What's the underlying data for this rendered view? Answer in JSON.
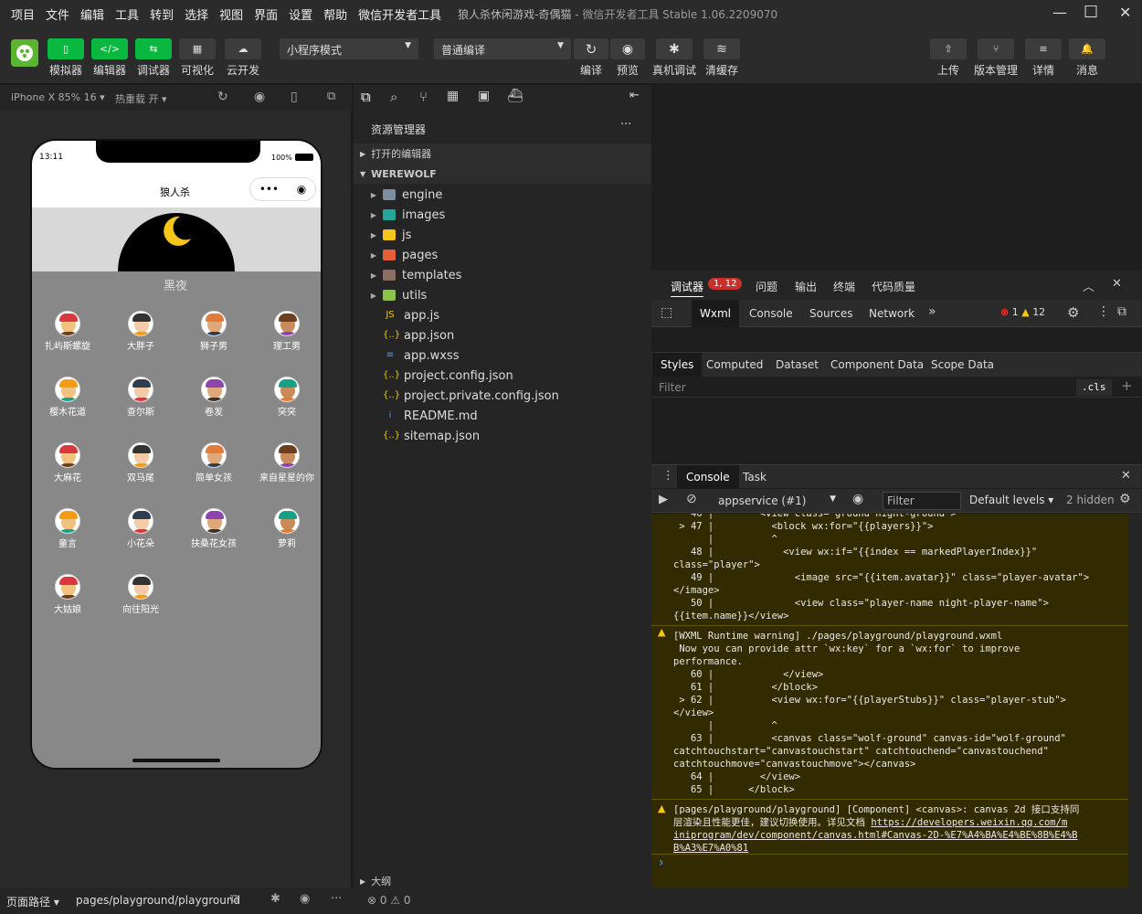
{
  "menu": [
    "项目",
    "文件",
    "编辑",
    "工具",
    "转到",
    "选择",
    "视图",
    "界面",
    "设置",
    "帮助",
    "微信开发者工具"
  ],
  "window": {
    "title": "狼人杀休闲游戏-奇偶猫",
    "subtitle": "- 微信开发者工具 Stable 1.06.2209070",
    "minimize": "—",
    "maximize": "☐",
    "close": "✕"
  },
  "toolbar": {
    "left": [
      {
        "label": "模拟器",
        "glyph": "▯"
      },
      {
        "label": "编辑器",
        "glyph": "</>"
      },
      {
        "label": "调试器",
        "glyph": "⇆"
      },
      {
        "label": "可视化",
        "glyph": "▦"
      },
      {
        "label": "云开发",
        "glyph": "☁"
      }
    ],
    "mode_select": "小程序模式",
    "compile_select": "普通编译",
    "middle": [
      {
        "label": "编译",
        "glyph": "↻"
      },
      {
        "label": "预览",
        "glyph": "◉"
      },
      {
        "label": "真机调试",
        "glyph": "✱"
      },
      {
        "label": "清缓存",
        "glyph": "≋"
      }
    ],
    "right": [
      {
        "label": "上传",
        "glyph": "⇧"
      },
      {
        "label": "版本管理",
        "glyph": "⑂"
      },
      {
        "label": "详情",
        "glyph": "≡"
      },
      {
        "label": "消息",
        "glyph": "🔔"
      }
    ]
  },
  "simbar": {
    "device": "iPhone X 85% 16 ▾",
    "hotreload": "热重载 开 ▾"
  },
  "phone": {
    "time": "13:11",
    "battery": "100%",
    "title": "狼人杀",
    "night_label": "黑夜",
    "players": [
      "扎屿斯螺旋",
      "大胖子",
      "狮子男",
      "理工男",
      "樱木花道",
      "查尔斯",
      "卷发",
      "突突",
      "大麻花",
      "双马尾",
      "简单女孩",
      "来自星星的你",
      "童言",
      "小花朵",
      "扶桑花女孩",
      "萝莉",
      "大姑娘",
      "向往阳光"
    ]
  },
  "explorer": {
    "header": "资源管理器",
    "more": "···",
    "open_editors": "打开的编辑器",
    "root": "WEREWOLF",
    "items": [
      {
        "name": "engine",
        "folder": true,
        "color": "#7d8ea3"
      },
      {
        "name": "images",
        "folder": true,
        "color": "#26a69a"
      },
      {
        "name": "js",
        "folder": true,
        "color": "#f5c518"
      },
      {
        "name": "pages",
        "folder": true,
        "color": "#e85d3a"
      },
      {
        "name": "templates",
        "folder": true,
        "color": "#8d6e63"
      },
      {
        "name": "utils",
        "folder": true,
        "color": "#8bc34a"
      },
      {
        "name": "app.js",
        "folder": false,
        "icon": "JS",
        "color": "#f5c518"
      },
      {
        "name": "app.json",
        "folder": false,
        "icon": "{..}",
        "color": "#f5c518"
      },
      {
        "name": "app.wxss",
        "folder": false,
        "icon": "≡",
        "color": "#42a5f5"
      },
      {
        "name": "project.config.json",
        "folder": false,
        "icon": "{..}",
        "color": "#f5c518"
      },
      {
        "name": "project.private.config.json",
        "folder": false,
        "icon": "{..}",
        "color": "#f5c518"
      },
      {
        "name": "README.md",
        "folder": false,
        "icon": "i",
        "color": "#42a5f5"
      },
      {
        "name": "sitemap.json",
        "folder": false,
        "icon": "{..}",
        "color": "#f5c518"
      }
    ],
    "outline": "大纲",
    "errors": "⊗ 0 ⚠ 0"
  },
  "devtools": {
    "top_tabs": [
      "调试器",
      "问题",
      "输出",
      "终端",
      "代码质量"
    ],
    "badge": "1, 12",
    "panel_tabs": [
      "Wxml",
      "Console",
      "Sources",
      "Network"
    ],
    "error_count": "1",
    "warn_count": "12",
    "style_tabs": [
      "Styles",
      "Computed",
      "Dataset",
      "Component Data",
      "Scope Data"
    ],
    "filter": "Filter",
    "cls": ".cls",
    "drawer_tabs": [
      "Console",
      "Task"
    ],
    "context": "appservice (#1)",
    "console_filter": "Filter",
    "levels": "Default levels ▾",
    "hidden": "2 hidden",
    "block1": [
      "   46 |        <view class=\"ground night-ground\">",
      " > 47 |          <block wx:for=\"{{players}}\">",
      "      |          ^",
      "   48 |            <view wx:if=\"{{index == markedPlayerIndex}}\"",
      "class=\"player\">",
      "   49 |              <image src=\"{{item.avatar}}\" class=\"player-avatar\">",
      "</image>",
      "   50 |              <view class=\"player-name night-player-name\">",
      "{{item.name}}</view>"
    ],
    "block2": [
      "[WXML Runtime warning] ./pages/playground/playground.wxml",
      " Now you can provide attr `wx:key` for a `wx:for` to improve",
      "performance.",
      "   60 |            </view>",
      "   61 |          </block>",
      " > 62 |          <view wx:for=\"{{playerStubs}}\" class=\"player-stub\">",
      "</view>",
      "      |          ^",
      "   63 |          <canvas class=\"wolf-ground\" canvas-id=\"wolf-ground\"",
      "catchtouchstart=\"canvastouchstart\" catchtouchend=\"canvastouchend\"",
      "catchtouchmove=\"canvastouchmove\"></canvas>",
      "   64 |        </view>",
      "   65 |      </block>"
    ],
    "block3": [
      "[pages/playground/playground] [Component] <canvas>: canvas 2d 接口支持同",
      "层渲染且性能更佳，建议切换使用。详见文档 "
    ],
    "link": [
      "https://developers.weixin.qq.com/m",
      "iniprogram/dev/component/canvas.html#Canvas-2D-%E7%A4%BA%E4%BE%8B%E4%B",
      "B%A3%E7%A0%81"
    ],
    "prompt": "›"
  },
  "status": {
    "path_label": "页面路径 ▾",
    "path": "pages/playground/playground"
  },
  "colors": {
    "green": "#09b83e",
    "badge": "#c9302c",
    "warn_bg": "#332b00",
    "warn_border": "#665500"
  }
}
